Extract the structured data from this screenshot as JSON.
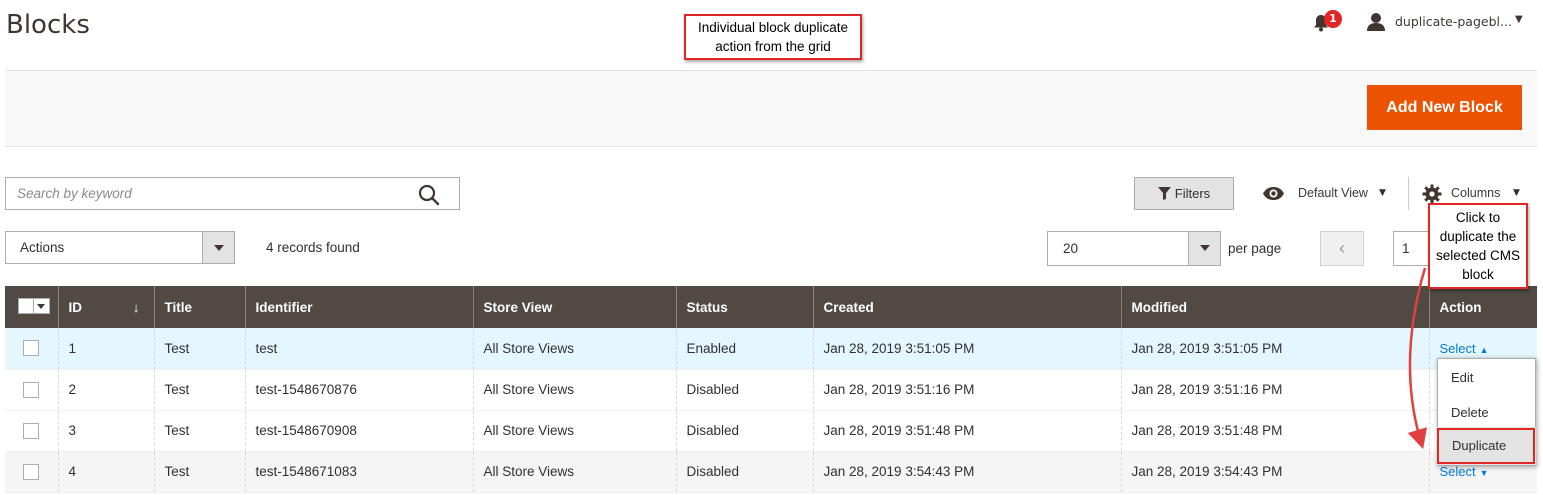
{
  "header": {
    "title": "Blocks",
    "notification_count": "1",
    "user_name": "duplicate-pagebl...",
    "callout_top": "Individual block duplicate action from the grid",
    "callout_right": "Click to duplicate the selected CMS block"
  },
  "page_actions": {
    "add_button": "Add New Block"
  },
  "toolbar": {
    "search_placeholder": "Search by keyword",
    "filters_label": "Filters",
    "view_label": "Default View",
    "columns_label": "Columns",
    "mass_action_label": "Actions",
    "records_found": "4 records found",
    "page_size": "20",
    "per_page_label": "per page",
    "current_page": "1"
  },
  "grid": {
    "columns": [
      "ID",
      "Title",
      "Identifier",
      "Store View",
      "Status",
      "Created",
      "Modified",
      "Action"
    ],
    "rows": [
      {
        "id": "1",
        "title": "Test",
        "identifier": "test",
        "store_view": "All Store Views",
        "status": "Enabled",
        "created": "Jan 28, 2019 3:51:05 PM",
        "modified": "Jan 28, 2019 3:51:05 PM",
        "action": "Select"
      },
      {
        "id": "2",
        "title": "Test",
        "identifier": "test-1548670876",
        "store_view": "All Store Views",
        "status": "Disabled",
        "created": "Jan 28, 2019 3:51:16 PM",
        "modified": "Jan 28, 2019 3:51:16 PM",
        "action": ""
      },
      {
        "id": "3",
        "title": "Test",
        "identifier": "test-1548670908",
        "store_view": "All Store Views",
        "status": "Disabled",
        "created": "Jan 28, 2019 3:51:48 PM",
        "modified": "Jan 28, 2019 3:51:48 PM",
        "action": ""
      },
      {
        "id": "4",
        "title": "Test",
        "identifier": "test-1548671083",
        "store_view": "All Store Views",
        "status": "Disabled",
        "created": "Jan 28, 2019 3:54:43 PM",
        "modified": "Jan 28, 2019 3:54:43 PM",
        "action": "Select"
      }
    ],
    "action_menu": [
      "Edit",
      "Delete",
      "Duplicate"
    ]
  },
  "colors": {
    "accent": "#eb5202",
    "header_bg": "#514943",
    "link": "#007bdb",
    "callout_border": "#e22626"
  }
}
